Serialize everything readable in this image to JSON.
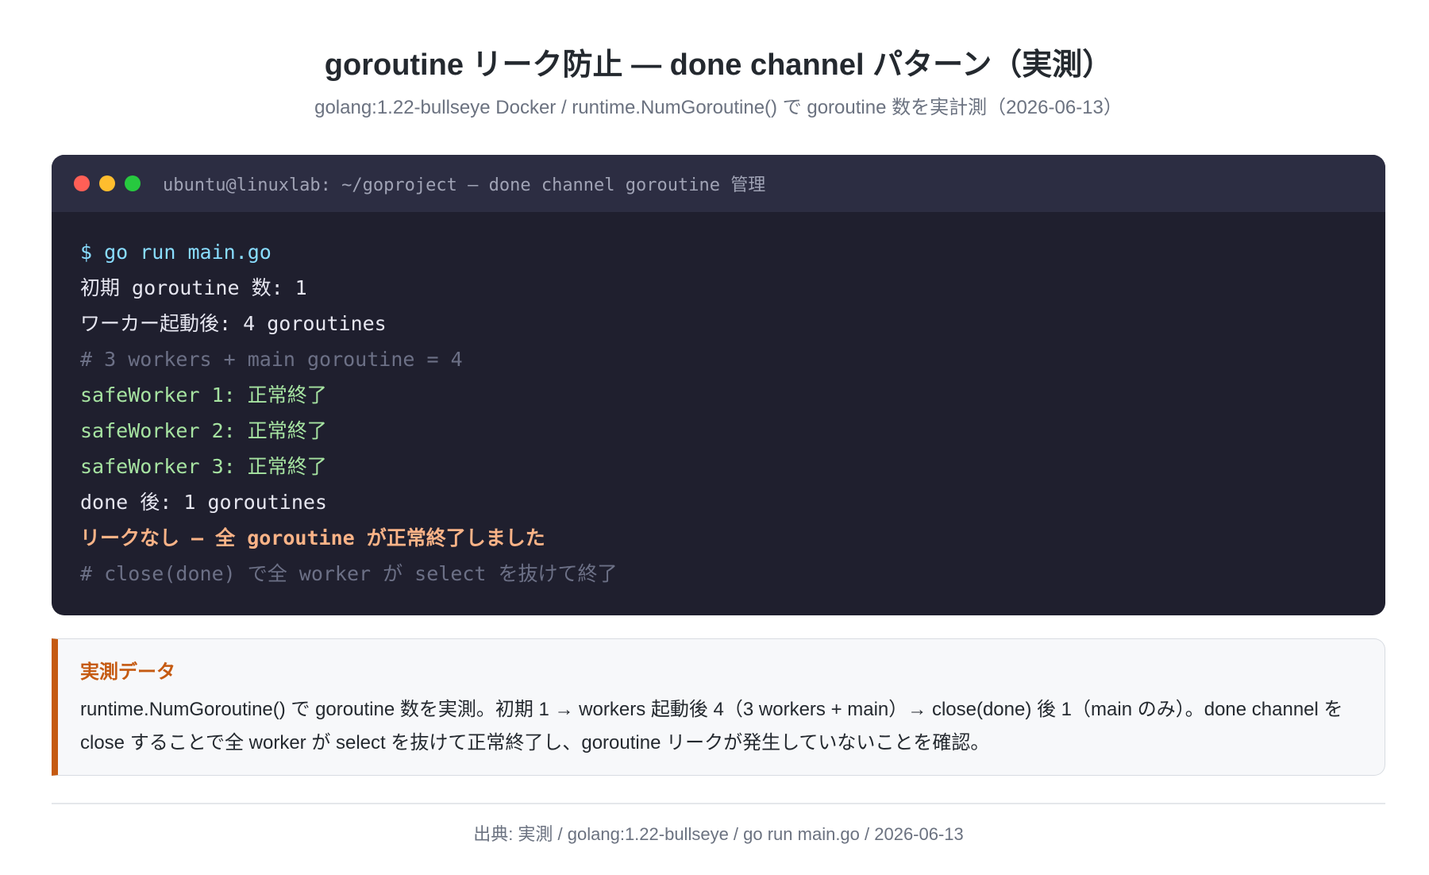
{
  "header": {
    "title": "goroutine リーク防止 — done channel パターン（実測）",
    "subtitle": "golang:1.22-bullseye Docker / runtime.NumGoroutine() で goroutine 数を実計測（2026-06-13）"
  },
  "terminal": {
    "title": "ubuntu@linuxlab: ~/goproject — done channel goroutine 管理",
    "dots": {
      "red": "#ff5f56",
      "yellow": "#ffbd2e",
      "green": "#27c93f"
    },
    "lines": [
      {
        "text": "$ go run main.go",
        "kind": "cmd"
      },
      {
        "text": "初期 goroutine 数: 1",
        "kind": "out"
      },
      {
        "text": "ワーカー起動後: 4 goroutines",
        "kind": "out"
      },
      {
        "text": "# 3 workers + main goroutine = 4",
        "kind": "comment"
      },
      {
        "text": "safeWorker 1: 正常終了",
        "kind": "ok"
      },
      {
        "text": "safeWorker 2: 正常終了",
        "kind": "ok"
      },
      {
        "text": "safeWorker 3: 正常終了",
        "kind": "ok"
      },
      {
        "text": "done 後: 1 goroutines",
        "kind": "out"
      },
      {
        "text": "リークなし — 全 goroutine が正常終了しました",
        "kind": "warn"
      },
      {
        "text": "# close(done) で全 worker が select を抜けて終了",
        "kind": "comment"
      }
    ]
  },
  "note": {
    "title": "実測データ",
    "text": "runtime.NumGoroutine() で goroutine 数を実測。初期 1 → workers 起動後 4（3 workers + main）→ close(done) 後 1（main のみ）。done channel を close することで全 worker が select を抜けて正常終了し、goroutine リークが発生していないことを確認。",
    "accent": "#c55a11"
  },
  "footer": {
    "source": "出典: 実測 / golang:1.22-bullseye / go run main.go / 2026-06-13"
  }
}
